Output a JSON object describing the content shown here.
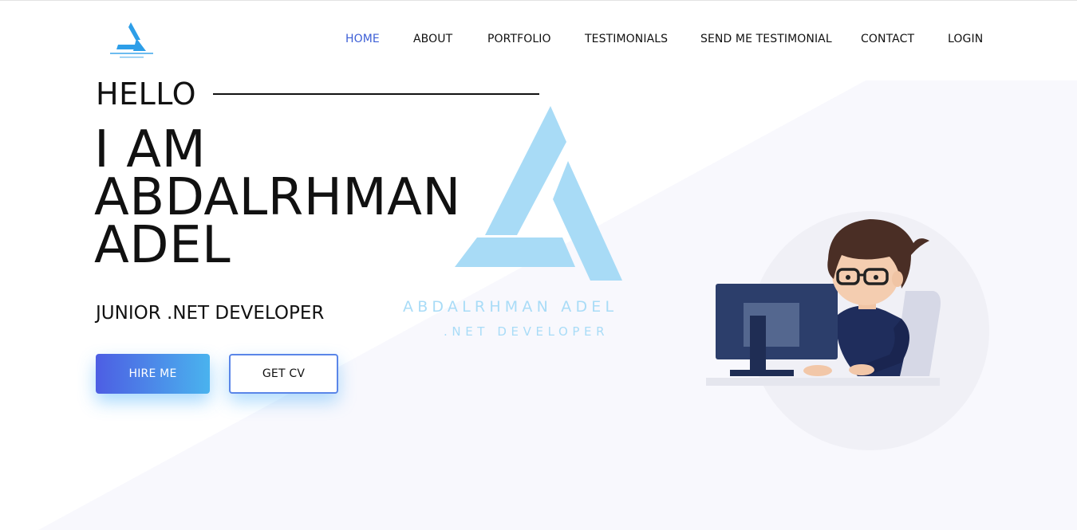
{
  "colors": {
    "accent": "#3d5fd6",
    "button_gradient_start": "#4d5ee3",
    "button_gradient_end": "#4ab3ee",
    "watermark": "#a9dcf7",
    "background_shape": "#f7f7fd"
  },
  "header": {
    "logo_icon": "triangle-a-logo",
    "nav": [
      {
        "label": "HOME",
        "active": true
      },
      {
        "label": "ABOUT"
      },
      {
        "label": "PORTFOLIO"
      },
      {
        "label": "TESTIMONIALS"
      },
      {
        "label": "SEND ME TESTIMONIAL"
      },
      {
        "label": "CONTACT"
      },
      {
        "label": "LOGIN"
      }
    ]
  },
  "hero": {
    "greeting": "HELLO",
    "name_line1": "I AM",
    "name_line2": "ABDALRHMAN",
    "name_line3": "ADEL",
    "role": "JUNIOR .NET DEVELOPER",
    "hire_button": "HIRE ME",
    "cv_button": "GET CV"
  },
  "watermark": {
    "line1": "ABDALRHMAN ADEL",
    "line2": ".NET DEVELOPER"
  },
  "illustration_icon": "developer-at-computer-illustration"
}
